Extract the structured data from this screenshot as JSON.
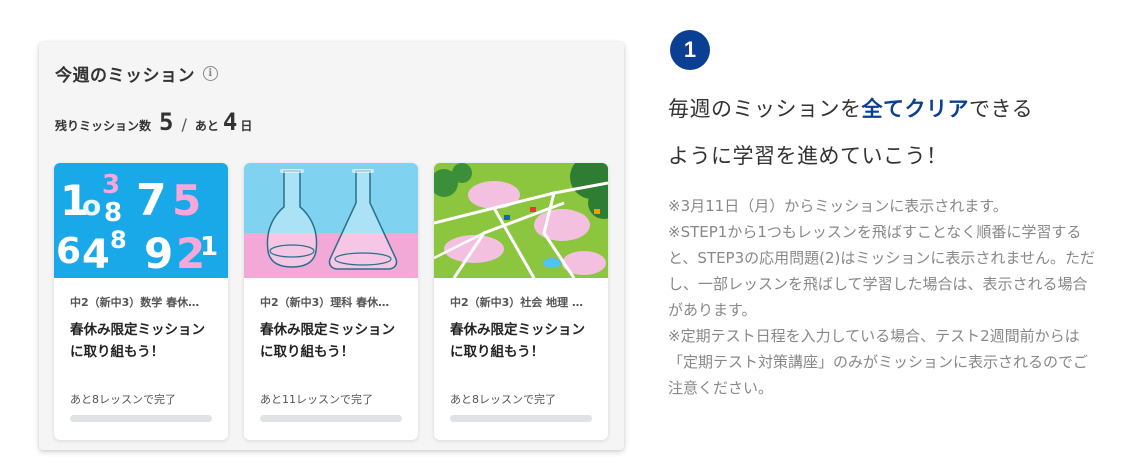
{
  "panel": {
    "title": "今週のミッション",
    "info_icon": "info-icon",
    "remaining_label": "残りミッション数",
    "remaining_count": "5",
    "days_label": "あと",
    "days_count": "4",
    "days_unit": "日"
  },
  "cards": [
    {
      "subject": "中2（新中3）数学 春休…",
      "title_line1": "春休み限定ミッション",
      "title_line2": "に取り組もう！",
      "remaining": "あと8レッスンで完了",
      "progress": 0,
      "thumb": "math-numbers-illustration"
    },
    {
      "subject": "中2（新中3）理科 春休…",
      "title_line1": "春休み限定ミッション",
      "title_line2": "に取り組もう！",
      "remaining": "あと11レッスンで完了",
      "progress": 0,
      "thumb": "science-flasks-illustration"
    },
    {
      "subject": "中2（新中3）社会 地理 …",
      "title_line1": "春休み限定ミッション",
      "title_line2": "に取り組もう！",
      "remaining": "あと8レッスンで完了",
      "progress": 0,
      "thumb": "social-map-illustration"
    }
  ],
  "step": {
    "number": "1",
    "headline_pre": "毎週のミッションを",
    "headline_highlight": "全てクリア",
    "headline_post": "できる",
    "headline_line2": "ように学習を進めていこう！",
    "notes": [
      "※3月11日（月）からミッションに表示されます。",
      "※STEP1から1つもレッスンを飛ばすことなく順番に学習すると、STEP3の応用問題(2)はミッションに表示されません。ただし、一部レッスンを飛ばして学習した場合は、表示される場合があります。",
      "※定期テスト日程を入力している場合、テスト2週間前からは「定期テスト対策講座」のみがミッションに表示されるのでご注意ください。"
    ]
  },
  "colors": {
    "accent": "#0b3f94",
    "math_bg": "#1aa9e8",
    "science_top": "#7fd3f0",
    "science_bottom": "#f2a9d7",
    "map_bg": "#8cc63f"
  }
}
